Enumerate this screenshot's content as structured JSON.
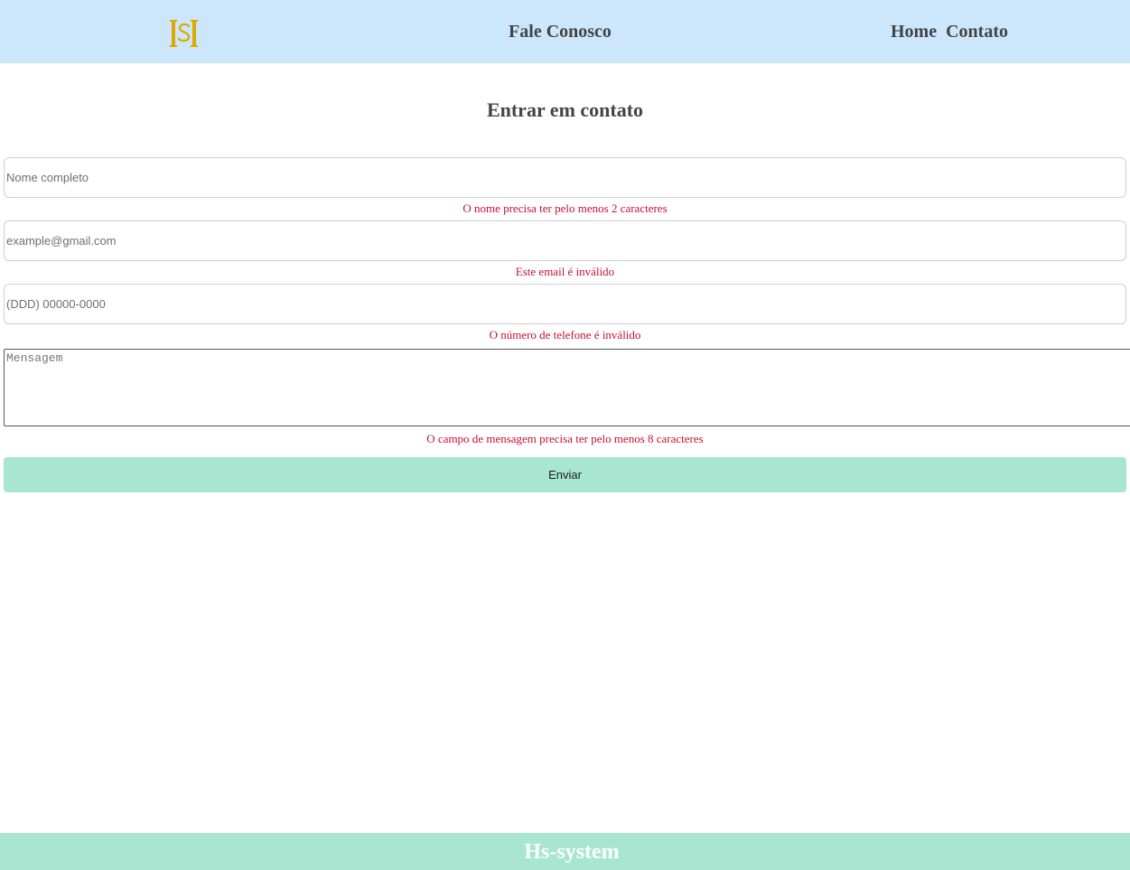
{
  "header": {
    "logo_text": "HS",
    "title": "Fale Conosco",
    "nav": [
      {
        "label": "Home"
      },
      {
        "label": "Contato"
      }
    ],
    "logo_color": "#e0a800",
    "background_color": "#cce6fb"
  },
  "form": {
    "heading": "Entrar em contato",
    "name": {
      "placeholder": "Nome completo",
      "error": "O nome precisa ter pelo menos 2 caracteres"
    },
    "email": {
      "placeholder": "example@gmail.com",
      "error": "Este email é inválido"
    },
    "phone": {
      "placeholder": "(DDD) 00000-0000",
      "error": "O número de telefone é inválido"
    },
    "message": {
      "placeholder": "Mensagem",
      "error": "O campo de mensagem precisa ter pelo menos 8 caracteres"
    },
    "submit_label": "Enviar",
    "error_color": "#c8102e",
    "button_color": "#a8e6d2"
  },
  "footer": {
    "text": "Hs-system",
    "background_color": "#a8e6d2"
  }
}
